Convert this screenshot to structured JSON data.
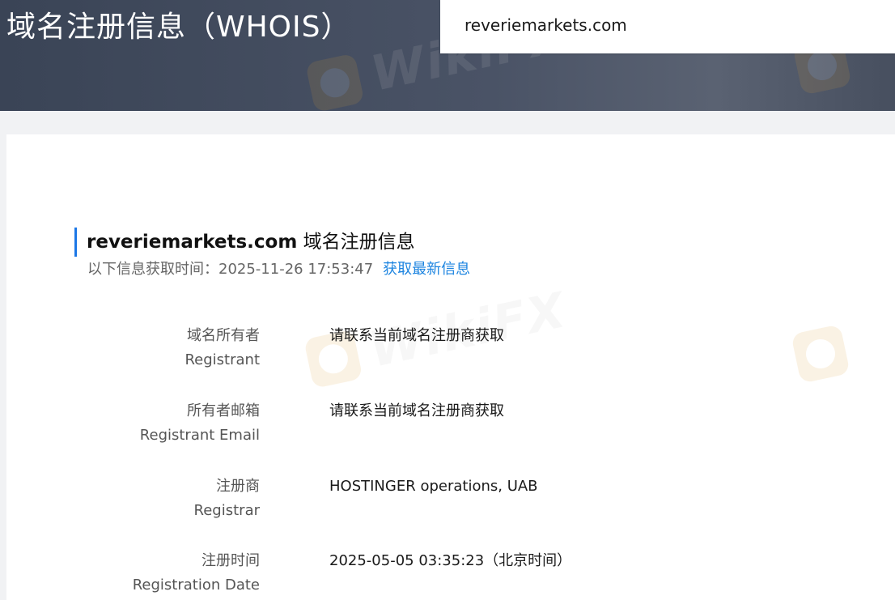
{
  "header": {
    "title": "域名注册信息（WHOIS）",
    "search_value": "reveriemarkets.com"
  },
  "section": {
    "domain": "reveriemarkets.com",
    "title_suffix": " 域名注册信息",
    "fetch_label": "以下信息获取时间：",
    "fetch_time": "2025-11-26 17:53:47",
    "refresh_link": "获取最新信息"
  },
  "rows": [
    {
      "label_cn": "域名所有者",
      "label_en": "Registrant",
      "value": "请联系当前域名注册商获取"
    },
    {
      "label_cn": "所有者邮箱",
      "label_en": "Registrant Email",
      "value": "请联系当前域名注册商获取"
    },
    {
      "label_cn": "注册商",
      "label_en": "Registrar",
      "value": "HOSTINGER operations, UAB"
    },
    {
      "label_cn": "注册时间",
      "label_en": "Registration Date",
      "value": "2025-05-05 03:35:23（北京时间）"
    }
  ],
  "watermark": {
    "text": "WikiFX",
    "icon": "wikifx-logo-icon"
  },
  "colors": {
    "header_bg": "#3f4859",
    "accent_blue": "#1c84e0",
    "section_bar": "#1c77e6"
  }
}
